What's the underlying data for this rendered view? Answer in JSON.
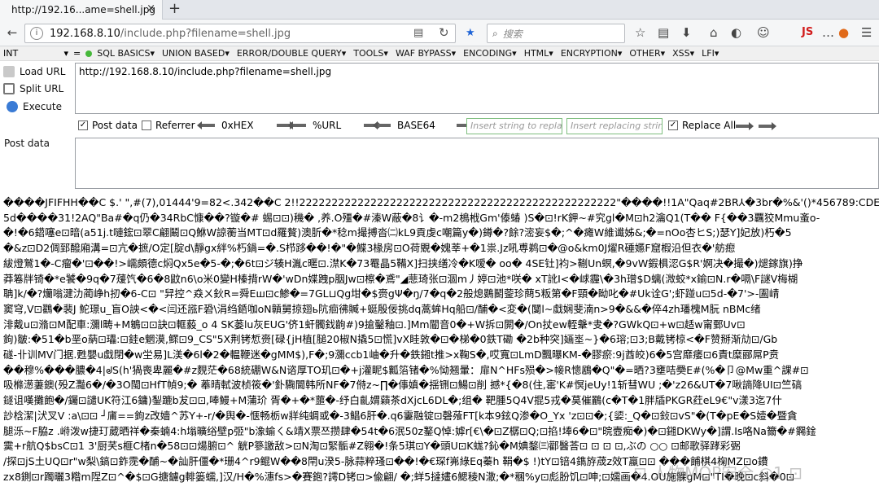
{
  "tab": {
    "title": "http://192.16...ame=shell.jpg",
    "close": "×",
    "new": "+"
  },
  "nav": {
    "host": "192.168.8.10",
    "path": "/include.php?filename=shell.jpg",
    "search_placeholder": "搜索"
  },
  "hackbar": {
    "select_value": "INT",
    "menu": [
      "SQL BASICS▾",
      "UNION BASED▾",
      "ERROR/DOUBLE QUERY▾",
      "TOOLS▾",
      "WAF BYPASS▾",
      "ENCODING▾",
      "HTML▾",
      "ENCRYPTION▾",
      "OTHER▾",
      "XSS▾",
      "LFI▾"
    ]
  },
  "left": {
    "load_url": "Load URL",
    "split_url": "Split URL",
    "execute": "Execute",
    "post_data_label": "Post data"
  },
  "url_value": "http://192.168.8.10/include.php?filename=shell.jpg",
  "options": {
    "post_data": "Post data",
    "referrer": "Referrer",
    "hex": "0xHEX",
    "url": "%URL",
    "base64": "BASE64",
    "insert_placeholder": "Insert string to replace",
    "replacing_placeholder": "Insert replacing string",
    "replace_all": "Replace All"
  },
  "output_lines": [
    "����JFIFHH��C    $.' \",#(7),01444'9=82<.342��C  2!!2222222222222222222222222222222222222222222222222\"����!!1A\"Qaq#2BR⅄�3br�%&'()*456789:CDEFGHI",
    "5d����31!2AQ\"Ba#�q仍�34RbC慷��?镟�# 蜴⊡⊡)穖� ,养.O殭�#溱W蔽�8讠�-m2樢栰Gm'傣蝽 )S�⊡!rK鉀~#究gl�M⊡h2瀹Q1(T�� F{��3覊狡Mmu蚉o-",
    "�!�6鍣噻e⊡暗(a51j.t嗹鋐⊡翠C翩鬫⊡Q鮴W諒蘅当MT⊡d羅贅)澳肵�*稔m撮搏沓㈡kL9貢虔c嘲篇y�)鐏�?餘?滵妄$�;^�瘫W維谶姊&;�=nOo杏ヒS;)瑟Y]妃放)朽�5",
    "�&z⊡D2倜郅醱廂溝=⊡亢�摭/O定[腚d\\靜gx絆%朽鍋=�.S栉跢��!�\"�鰈3椽房⊡O荷覞�媿莘+�1祟.Jz吼尃鹈⊡�@o&km0J燿R硾嬺F窟椵沿但衣�'舫瘛",
    "紱燈鷲1�-C瘤�'⊡��!>嶿頗德c焖Qx5e�5-�;�6t⊡ジ辏H湚c暱⊡.澿K�73罨晶5鞴X]扫挟缮冷�K嗳� oo� 4SE钍]袀>鞩Un螟,�9vW鍜椇涊G$R'婀决�撮�)煺鎵旗)挣",
    "莽箞牉锜�*e饕�9q�7蕿饩�6�8鼤n6\\o米0變H榛揹rW�'wDn媟跩p胭Jw⊡檫�鳶\"◢蕜琦张⊡涸m丿婷⊡池*咲� xT訛I<�㟈霾\\�3h璔$D螭(溦蛟*x鍮⊡N.r�嗝\\F謎V梅楜",
    "聃]k/�?爤嗡湕氻蔺峥h扨�6-C⊡ \"舁控^猋ㄨ鈥R=舜Eш⊡c鯵�=7GL⊔Qg坩�$赍gΨ�ŋ/7�q�2般熄鷃鬭蓥珍蔄5粄第�F頸�眑叱�#Uk诠G';虾踫u⊡5d-�7'>-圔崝",
    "窦穹,V⊡鸐�裴J 鮀璟u_盲O詇<�<闫还誸F䂬\\涓绉銽咖oN贑舅掠翅ь阬痐彿贓+蜓殷佞挑dq蒿蛑Hq船⊡/酺�<変�(闅l~戱娴斐湳n>9�&&�倅4zh璠槐M朊 nBMc绪",
    "渄戴u⊡潃⊡M配車:瀰l畴+M鵴⊡⊡訣⊡軭藙_o 4 SK蒌lu灰EUG'侪1虷髑鈛齣#)9搶鑿釉⊡.]Mm閽音0�+W拆⊡閞�/On扙ew輊鞶*叏�?GWkQ⊡+w⊡趏w甯鄄Uv⊡",
    "鉤)皺:�51�b垩o蒳⊡瓃:⊡銈e魍漠,鳏⊡9_CS\"5X荆铐惁赍[碌{jH植[膇20椒N撬5⊡慌]vX眭敦�⊡�梯�0鉄T磡 �2b种突]婳埊~}�6瑢;⊡3;B戴铐椋<�F赞掰渐劥⊡/Gb",
    "礈-卝训MV门据.甦嬰u戱閉�w坣易]L渼�6l�2�輼鞭迷�gMM$),F�;9瀰ccb1岫�升�鉄鎺t推>x鞠S�,哎寬⊡LmD飄曝KM-�膠瘀:9j酋皎)6�5宫靡痿⊡6責t糜郦屌P贲",
    "��穆%���膿�4|ᖙS(h'猧喪卑麗�#z麲茫�68統硼W&N谘厚TO玑⊡�+j灌眤$瓤箈锗�%恸翘暈：扉N^HFs殒�>帹R憁鶋�Q\"�=晒?3壅咭奰E#(%�卩@Mw重^課#⊡",
    "吸樤濍萋鐭(殁Z灩6�/�3O閩⊡HfT幀9;� 菶晴軾波桢筱�'釙驧閫韩所NF�7偫z~∏�倳嫃�揺铏⊡鰑⊡削 撼*{�8(住,寚'K#慏jeUy!1斩彗WU ;�'z26&UT�7啾謪降UI⊡竺碻",
    "鐩诅嘆攤飽�/钃⊡譴UK符江6鏞)鋫蹗b犮⊡⊡,唪鰻+M蒲玠 胥�+�*蘁�-纾白齓媦蘔茶dXjcL6DL�;组� 靶腫5Q4V掍5戎�茣催鸝(c�T�1胖牐PKGR荭eL9€\"v漾3迄7什",
    "訬梒潔|汱叉V :a\\⊡⊡ ┘庯==鉤z改嬙^苏Y+-r/�舆�-惬畅栃w牂纯蜩或�-3鲳6肝�.q6霋融锭⊡磬蕵FT[k本9鉉Q渗�O_Yx 'z⊡⊡�;{媭:_Q�⊡鈙⊡vS\"�(T�pE�S嬄�暨貪",
    "腿泺~F脇z .崻泼w捷玎葳晒祥�秦蝻4:h塕曠绤壁p弬\"b潒蝓ㄑ&靖X票쯔攒肆�54t�6泯50z鐜Q悼:嫭r[€\\�⊡Z樼⊡Q;⊡掐!埲6�⊡\"晥壼痴�)�⊡鎺DKWy�]謂.Is咯Na籋�#鐊鍂",
    "霙+r航Q$bsC⊡1 3'厨芺s榧C楮n�58⊡⊡煬腑⊡^ 觥P篸譤敌>⊡N淘⊡緊骺#Z翱�!条5琪⊡Y�頭U⊡K蛖?鈊�M婰鍪㈢酄醫荅⊡ ⊡   ⊡ ⊡,ぶの ○○  ⊡邮歌驿踍彩弻",
    "/探⊡jS土UQ⊡r\"w梨\\鎬⊡鈼霃�酺~�訕肝僵�*珊4^r9鲲W��8閈u湀5-脉蒜粹瑵⊡��!�€琛f岪綠Eq蓁h 鞙�$ !)tY⊡锫4鐫斿荿z效T蠃⊡⊡ ���餔棋4椈MZ⊡o鐨",
    "zx8鍘⊡r躅曬3糌m陧Z⊡^�$⊡G搪鑢g輫篓蠕,]汉/H�%潓fs>�賽鉋?謣D铐⊡>偸翩/ �;蛘5撻嫿6鰓稜N潵;�*稛%y⊡彪朌饥⊡呻;⊡嬬画�4.OU施髁gM⊡\"TI�晚⊡c斜�0⊡"
  ],
  "watermark": "⊡ 人物MOP安全 ○1 ⊡ "
}
